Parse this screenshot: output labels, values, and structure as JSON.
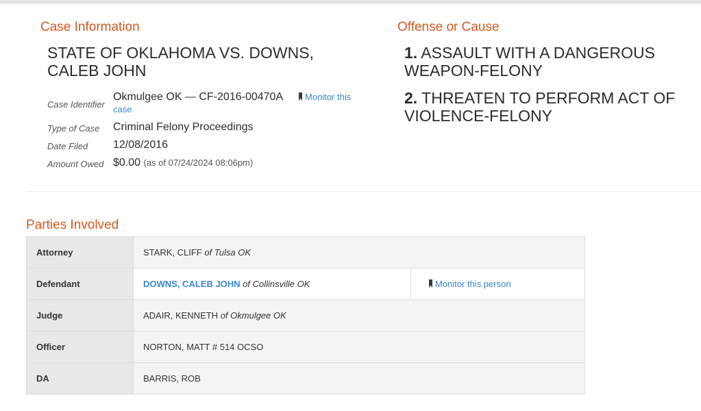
{
  "case_info": {
    "heading": "Case Information",
    "title_line1": "STATE OF OKLAHOMA VS. DOWNS,",
    "title_line2": "CALEB JOHN",
    "identifier_label": "Case Identifier",
    "identifier_value": "Okmulgee OK — CF-2016-00470A",
    "monitor_case_part1": "Monitor this",
    "monitor_case_part2": "case",
    "type_label": "Type of Case",
    "type_value": "Criminal Felony Proceedings",
    "date_label": "Date Filed",
    "date_value": "12/08/2016",
    "amount_label": "Amount Owed",
    "amount_value": "$0.00",
    "amount_asof": "(as of 07/24/2024 08:06pm)"
  },
  "offense": {
    "heading": "Offense or Cause",
    "items": [
      {
        "num": "1.",
        "line1": " ASSAULT WITH A DANGEROUS",
        "line2": "WEAPON-FELONY"
      },
      {
        "num": "2.",
        "line1": " THREATEN TO PERFORM ACT OF",
        "line2": "VIOLENCE-FELONY"
      }
    ]
  },
  "parties": {
    "heading": "Parties Involved",
    "rows": [
      {
        "role": "Attorney",
        "name": "STARK, CLIFF",
        "origin": " of Tulsa OK"
      },
      {
        "role": "Defendant",
        "name": "DOWNS, CALEB JOHN",
        "origin": " of Collinsville OK",
        "monitor": "Monitor this person"
      },
      {
        "role": "Judge",
        "name": "ADAIR, KENNETH",
        "origin": " of Okmulgee OK"
      },
      {
        "role": "Officer",
        "name": "NORTON, MATT # 514 OCSO",
        "origin": ""
      },
      {
        "role": "DA",
        "name": "BARRIS, ROB",
        "origin": ""
      }
    ]
  }
}
